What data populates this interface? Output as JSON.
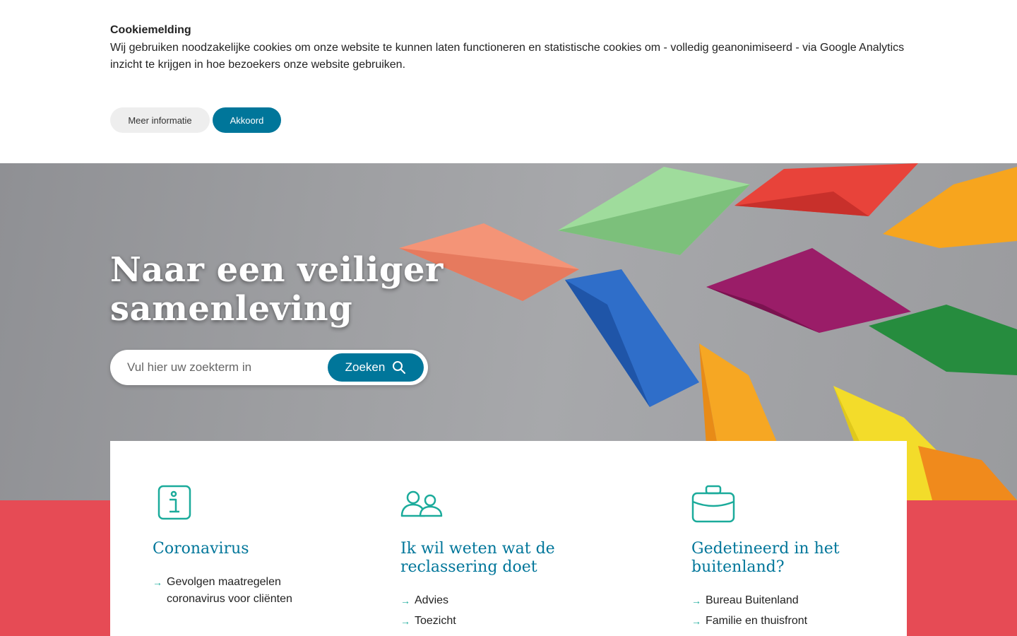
{
  "cookie": {
    "title": "Cookiemelding",
    "text": "Wij gebruiken noodzakelijke cookies om onze website te kunnen laten functioneren en statistische cookies om - volledig geanonimiseerd - via Google Analytics inzicht te krijgen in hoe bezoekers onze website gebruiken.",
    "more_label": "Meer informatie",
    "accept_label": "Akkoord"
  },
  "hero": {
    "title": "Naar een veiliger samenleving",
    "search_placeholder": "Vul hier uw zoekterm in",
    "search_button": "Zoeken"
  },
  "columns": [
    {
      "icon": "info-icon",
      "title": "Coronavirus",
      "links": [
        "Gevolgen maatregelen coronavirus voor cliënten"
      ]
    },
    {
      "icon": "people-icon",
      "title": "Ik wil weten wat de reclassering doet",
      "links": [
        "Advies",
        "Toezicht"
      ]
    },
    {
      "icon": "briefcase-icon",
      "title": "Gedetineerd in het buitenland?",
      "links": [
        "Bureau Buitenland",
        "Familie en thuisfront"
      ]
    }
  ],
  "colors": {
    "primary": "#00769a",
    "accent_red": "#e64b55",
    "icon_teal": "#1bab9b"
  }
}
